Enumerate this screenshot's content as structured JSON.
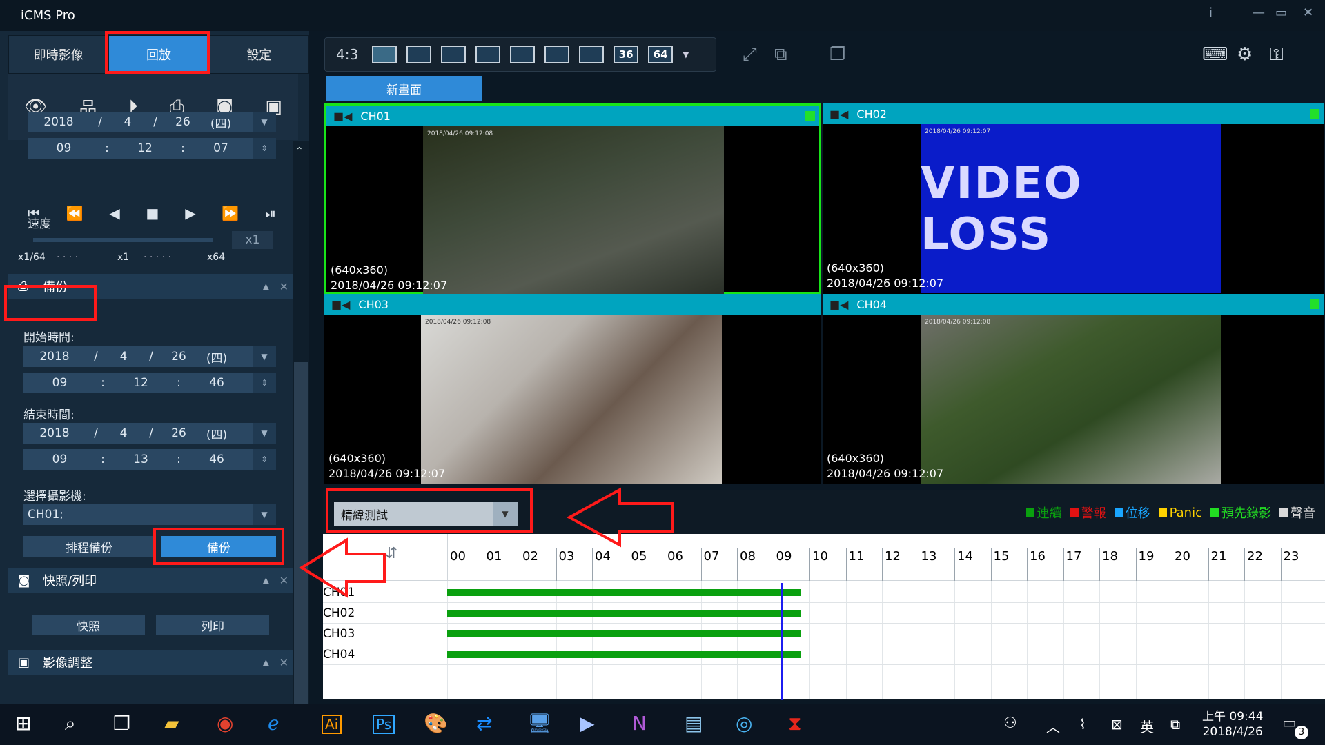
{
  "app": {
    "title": "iCMS Pro"
  },
  "left_panel": {
    "tabs": [
      "即時影像",
      "回放",
      "設定"
    ],
    "active_tab": "回放",
    "playback": {
      "date": {
        "year": "2018",
        "month": "4",
        "day": "26",
        "weekday": "(四)"
      },
      "time": {
        "hour": "09",
        "minute": "12",
        "second": "07"
      },
      "speed_label": "速度",
      "speed_value": "x1",
      "speed_min": "x1/64",
      "speed_mid": "x1",
      "speed_max": "x64"
    },
    "backup": {
      "section_title": "備份",
      "start_label": "開始時間:",
      "start_date": {
        "year": "2018",
        "month": "4",
        "day": "26",
        "weekday": "(四)"
      },
      "start_time": {
        "hour": "09",
        "minute": "12",
        "second": "46"
      },
      "end_label": "結束時間:",
      "end_date": {
        "year": "2018",
        "month": "4",
        "day": "26",
        "weekday": "(四)"
      },
      "end_time": {
        "hour": "09",
        "minute": "13",
        "second": "46"
      },
      "camera_label": "選擇攝影機:",
      "camera_value": "CH01;",
      "schedule_button": "排程備份",
      "backup_button": "備份"
    },
    "snapshot": {
      "section_title": "快照/列印",
      "snapshot_button": "快照",
      "print_button": "列印"
    },
    "image_adjust": {
      "section_title": "影像調整"
    }
  },
  "toolbar": {
    "aspect": "4:3",
    "layout_36": "36",
    "layout_64": "64"
  },
  "new_screen_label": "新畫面",
  "channels": [
    {
      "name": "CH01",
      "resolution": "(640x360)",
      "timestamp": "2018/04/26 09:12:07",
      "osd": "2018/04/26 09:12:08"
    },
    {
      "name": "CH02",
      "resolution": "(640x360)",
      "timestamp": "2018/04/26 09:12:07",
      "osd": "2018/04/26 09:12:07",
      "video_loss": "VIDEO LOSS"
    },
    {
      "name": "CH03",
      "resolution": "(640x360)",
      "timestamp": "2018/04/26 09:12:07",
      "osd": "2018/04/26 09:12:08"
    },
    {
      "name": "CH04",
      "resolution": "(640x360)",
      "timestamp": "2018/04/26 09:12:07",
      "osd": "2018/04/26 09:12:08"
    }
  ],
  "timeline": {
    "filter_value": "精緯測試",
    "legend": [
      {
        "label": "連續",
        "color": "#0aa00f"
      },
      {
        "label": "警報",
        "color": "#e01212"
      },
      {
        "label": "位移",
        "color": "#1aa6ff"
      },
      {
        "label": "Panic",
        "color": "#ffd200"
      },
      {
        "label": "預先錄影",
        "color": "#22dd22"
      },
      {
        "label": "聲音",
        "color": "#d8d8d8"
      }
    ],
    "hours": [
      "00",
      "01",
      "02",
      "03",
      "04",
      "05",
      "06",
      "07",
      "08",
      "09",
      "10",
      "11",
      "12",
      "13",
      "14",
      "15",
      "16",
      "17",
      "18",
      "19",
      "20",
      "21",
      "22",
      "23"
    ],
    "channels": [
      "CH01",
      "CH02",
      "CH03",
      "CH04"
    ],
    "recording_end_hour": 9.75,
    "cursor_hour": 9.2
  },
  "taskbar": {
    "time": "上午 09:44",
    "date": "2018/4/26",
    "ime": "英",
    "notification_count": "3"
  }
}
